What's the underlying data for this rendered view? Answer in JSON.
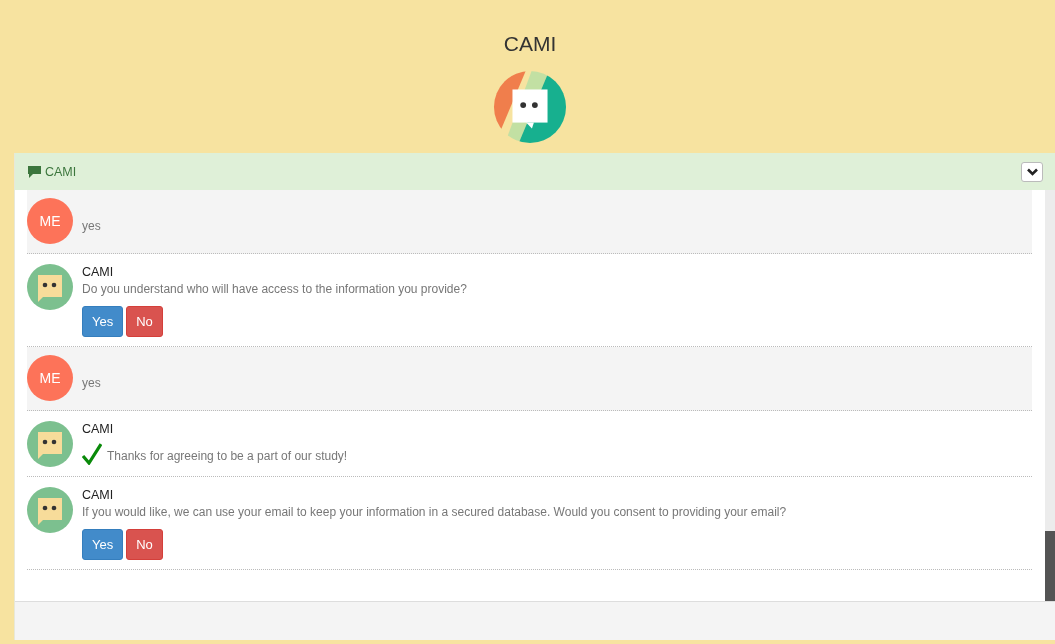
{
  "header": {
    "title": "CAMI"
  },
  "chat_panel": {
    "title": "CAMI",
    "collapsed": false
  },
  "messages": [
    {
      "kind": "user",
      "avatar": "ME",
      "text": "yes"
    },
    {
      "kind": "bot",
      "sender": "CAMI",
      "text": "Do you understand who will have access to the information you provide?",
      "confirmed": false,
      "buttons": [
        {
          "label": "Yes",
          "kind": "yes"
        },
        {
          "label": "No",
          "kind": "no"
        }
      ]
    },
    {
      "kind": "user",
      "avatar": "ME",
      "text": "yes"
    },
    {
      "kind": "bot",
      "sender": "CAMI",
      "text": "Thanks for agreeing to be a part of our study!",
      "confirmed": true
    },
    {
      "kind": "bot",
      "sender": "CAMI",
      "text": "If you would like, we can use your email to keep your information in a secured database. Would you consent to providing your email?",
      "confirmed": false,
      "buttons": [
        {
          "label": "Yes",
          "kind": "yes"
        },
        {
          "label": "No",
          "kind": "no"
        }
      ]
    }
  ]
}
